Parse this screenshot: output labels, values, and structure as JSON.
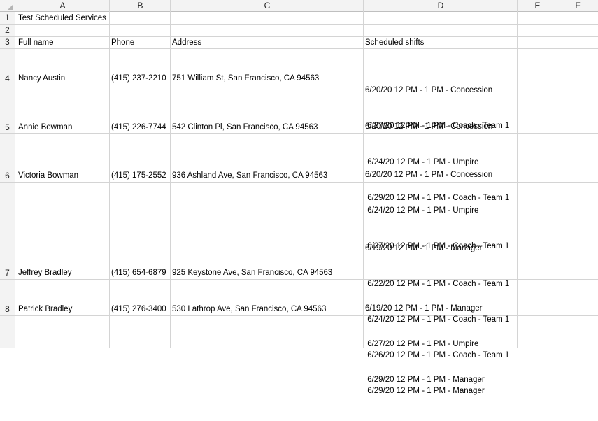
{
  "columns": [
    "A",
    "B",
    "C",
    "D",
    "E",
    "F"
  ],
  "row_numbers": [
    "1",
    "2",
    "3",
    "4",
    "5",
    "6",
    "7",
    "8"
  ],
  "title": "Test Scheduled Services",
  "headers": {
    "full_name": "Full name",
    "phone": "Phone",
    "address": "Address",
    "scheduled_shifts": "Scheduled shifts"
  },
  "records": [
    {
      "name": "Nancy Austin",
      "phone": "(415) 237-2210",
      "address": "751 William St, San Francisco, CA 94563",
      "shifts": [
        "6/20/20 12 PM - 1 PM - Concession",
        " 6/27/20 12 PM - 1 PM - Coach - Team 1"
      ]
    },
    {
      "name": "Annie Bowman",
      "phone": "(415) 226-7744",
      "address": "542 Clinton Pl, San Francisco, CA 94563",
      "shifts": [
        "6/20/20 12 PM - 1 PM - Concession",
        " 6/24/20 12 PM - 1 PM - Umpire",
        " 6/29/20 12 PM - 1 PM - Coach - Team 1"
      ]
    },
    {
      "name": "Victoria Bowman",
      "phone": "(415) 175-2552",
      "address": "936 Ashland Ave, San Francisco, CA 94563",
      "shifts": [
        "6/20/20 12 PM - 1 PM - Concession",
        " 6/24/20 12 PM - 1 PM - Umpire",
        " 6/27/20 12 PM - 1 PM - Coach - Team 1"
      ]
    },
    {
      "name": "Jeffrey Bradley",
      "phone": "(415) 654-6879",
      "address": "925 Keystone Ave, San Francisco, CA 94563",
      "shifts": [
        "6/19/20 12 PM - 1 PM - Manager",
        " 6/22/20 12 PM - 1 PM - Coach - Team 1",
        " 6/24/20 12 PM - 1 PM - Coach - Team 1",
        " 6/26/20 12 PM - 1 PM - Coach - Team 1",
        " 6/29/20 12 PM - 1 PM - Manager"
      ]
    },
    {
      "name": "Patrick Bradley",
      "phone": "(415) 276-3400",
      "address": "530 Lathrop Ave, San Francisco, CA 94563",
      "shifts": [
        "6/19/20 12 PM - 1 PM - Manager",
        " 6/27/20 12 PM - 1 PM - Umpire",
        " 6/29/20 12 PM - 1 PM - Manager"
      ]
    }
  ]
}
